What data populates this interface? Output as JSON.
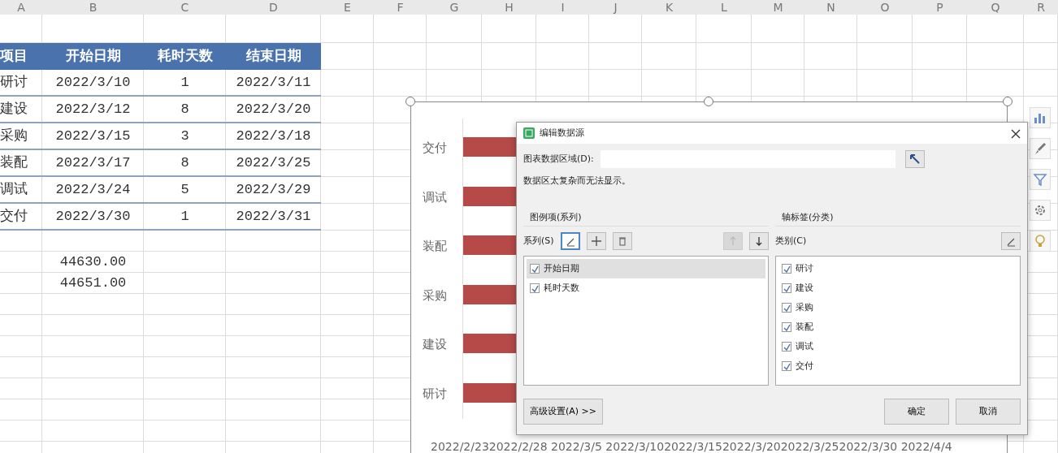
{
  "columns": [
    "A",
    "B",
    "C",
    "D",
    "E",
    "F",
    "G",
    "H",
    "I",
    "J",
    "K",
    "L",
    "M",
    "N",
    "O",
    "P",
    "Q",
    "R"
  ],
  "sheet": {
    "header": [
      "项目",
      "开始日期",
      "耗时天数",
      "结束日期"
    ],
    "rows": [
      [
        "研讨",
        "2022/3/10",
        "1",
        "2022/3/11"
      ],
      [
        "建设",
        "2022/3/12",
        "8",
        "2022/3/20"
      ],
      [
        "采购",
        "2022/3/15",
        "3",
        "2022/3/18"
      ],
      [
        "装配",
        "2022/3/17",
        "8",
        "2022/3/25"
      ],
      [
        "调试",
        "2022/3/24",
        "5",
        "2022/3/29"
      ],
      [
        "交付",
        "2022/3/30",
        "1",
        "2022/3/31"
      ]
    ],
    "values": [
      "44630.00",
      "44651.00"
    ]
  },
  "chart": {
    "categories": [
      "交付",
      "调试",
      "装配",
      "采购",
      "建设",
      "研讨"
    ],
    "axis_labels": "2022/2/232022/2/28 2022/3/5 2022/3/102022/3/152022/3/202022/3/252022/3/30 2022/4/4"
  },
  "dialog": {
    "title": "编辑数据源",
    "range_label": "图表数据区域(D):",
    "note": "数据区太复杂而无法显示。",
    "series_group": {
      "title": "图例项(系列)",
      "label": "系列(S)",
      "up_disabled": true,
      "items": [
        {
          "label": "开始日期",
          "checked": true,
          "selected": true
        },
        {
          "label": "耗时天数",
          "checked": true,
          "selected": false
        }
      ]
    },
    "category_group": {
      "title": "轴标签(分类)",
      "label": "类别(C)",
      "items": [
        {
          "label": "研讨",
          "checked": true
        },
        {
          "label": "建设",
          "checked": true
        },
        {
          "label": "采购",
          "checked": true
        },
        {
          "label": "装配",
          "checked": true
        },
        {
          "label": "调试",
          "checked": true
        },
        {
          "label": "交付",
          "checked": true
        }
      ]
    },
    "advanced_button": "高级设置(A) >>",
    "ok_button": "确定",
    "cancel_button": "取消"
  }
}
